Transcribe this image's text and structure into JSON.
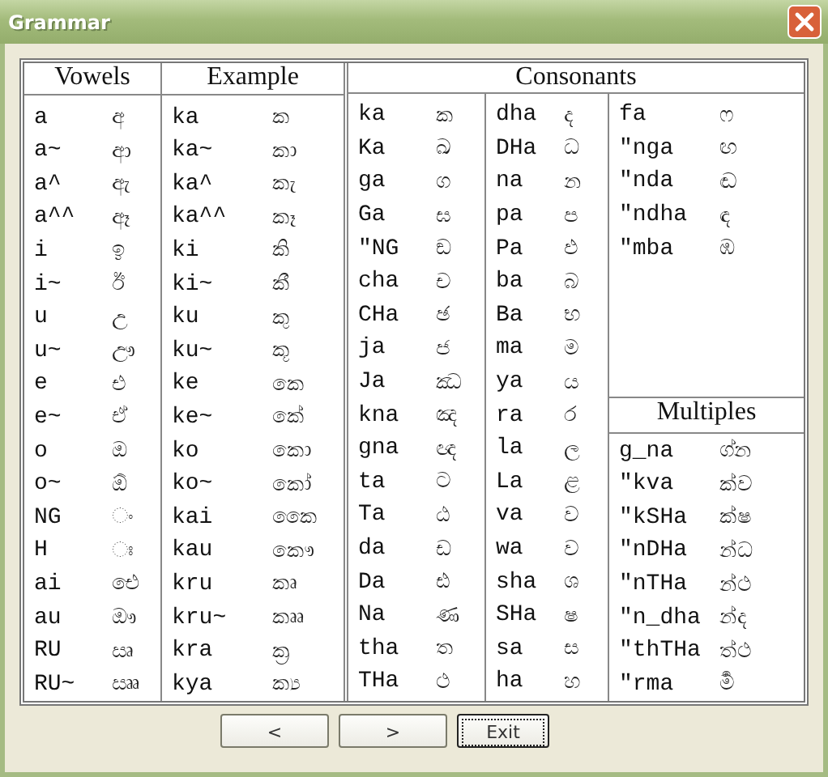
{
  "window": {
    "title": "Grammar"
  },
  "vowels": {
    "header": "Vowels",
    "rows": [
      {
        "code": "a",
        "glyph": "අ"
      },
      {
        "code": "a~",
        "glyph": "ආ"
      },
      {
        "code": "a^",
        "glyph": "ඇ"
      },
      {
        "code": "a^^",
        "glyph": "ඈ"
      },
      {
        "code": "i",
        "glyph": "ඉ"
      },
      {
        "code": "i~",
        "glyph": "ඊ"
      },
      {
        "code": "u",
        "glyph": "උ"
      },
      {
        "code": "u~",
        "glyph": "ඌ"
      },
      {
        "code": "e",
        "glyph": "එ"
      },
      {
        "code": "e~",
        "glyph": "ඒ"
      },
      {
        "code": "o",
        "glyph": "ඔ"
      },
      {
        "code": "o~",
        "glyph": "ඕ"
      },
      {
        "code": "NG",
        "glyph": "ං"
      },
      {
        "code": "H",
        "glyph": "ඃ"
      },
      {
        "code": "ai",
        "glyph": "ඓ"
      },
      {
        "code": "au",
        "glyph": "ඖ"
      },
      {
        "code": "RU",
        "glyph": "ඍ"
      },
      {
        "code": "RU~",
        "glyph": "ඎ"
      }
    ]
  },
  "example": {
    "header": "Example",
    "rows": [
      {
        "code": "ka",
        "glyph": "ක"
      },
      {
        "code": "ka~",
        "glyph": "කා"
      },
      {
        "code": "ka^",
        "glyph": "කැ"
      },
      {
        "code": "ka^^",
        "glyph": "කෑ"
      },
      {
        "code": "ki",
        "glyph": "කි"
      },
      {
        "code": "ki~",
        "glyph": "කී"
      },
      {
        "code": "ku",
        "glyph": "කු"
      },
      {
        "code": "ku~",
        "glyph": "කූ"
      },
      {
        "code": "ke",
        "glyph": "කෙ"
      },
      {
        "code": "ke~",
        "glyph": "කේ"
      },
      {
        "code": "ko",
        "glyph": "කො"
      },
      {
        "code": "ko~",
        "glyph": "කෝ"
      },
      {
        "code": "kai",
        "glyph": "කෛ"
      },
      {
        "code": "kau",
        "glyph": "කෞ"
      },
      {
        "code": "kru",
        "glyph": "කෘ"
      },
      {
        "code": "kru~",
        "glyph": "කෲ"
      },
      {
        "code": "kra",
        "glyph": "ක්‍ර"
      },
      {
        "code": "kya",
        "glyph": "ක්‍ය"
      }
    ]
  },
  "consonants": {
    "header": "Consonants",
    "columns": [
      [
        {
          "code": "ka",
          "glyph": "ක"
        },
        {
          "code": "Ka",
          "glyph": "ඛ"
        },
        {
          "code": "ga",
          "glyph": "ග"
        },
        {
          "code": "Ga",
          "glyph": "ඝ"
        },
        {
          "code": "\"NG",
          "glyph": "ඞ"
        },
        {
          "code": "cha",
          "glyph": "ච"
        },
        {
          "code": "CHa",
          "glyph": "ඡ"
        },
        {
          "code": "ja",
          "glyph": "ජ"
        },
        {
          "code": "Ja",
          "glyph": "ඣ"
        },
        {
          "code": "kna",
          "glyph": "ඤ"
        },
        {
          "code": "gna",
          "glyph": "ඥ"
        },
        {
          "code": "ta",
          "glyph": "ට"
        },
        {
          "code": "Ta",
          "glyph": "ඨ"
        },
        {
          "code": "da",
          "glyph": "ඩ"
        },
        {
          "code": "Da",
          "glyph": "ඪ"
        },
        {
          "code": "Na",
          "glyph": "ණ"
        },
        {
          "code": "tha",
          "glyph": "ත"
        },
        {
          "code": "THa",
          "glyph": "ථ"
        }
      ],
      [
        {
          "code": "dha",
          "glyph": "ද"
        },
        {
          "code": "DHa",
          "glyph": "ධ"
        },
        {
          "code": "na",
          "glyph": "න"
        },
        {
          "code": "pa",
          "glyph": "ප"
        },
        {
          "code": "Pa",
          "glyph": "ඵ"
        },
        {
          "code": "ba",
          "glyph": "බ"
        },
        {
          "code": "Ba",
          "glyph": "භ"
        },
        {
          "code": "ma",
          "glyph": "ම"
        },
        {
          "code": "ya",
          "glyph": "ය"
        },
        {
          "code": "ra",
          "glyph": "ර"
        },
        {
          "code": "la",
          "glyph": "ල"
        },
        {
          "code": "La",
          "glyph": "ළ"
        },
        {
          "code": "va",
          "glyph": "ව"
        },
        {
          "code": "wa",
          "glyph": "ව"
        },
        {
          "code": "sha",
          "glyph": "ශ"
        },
        {
          "code": "SHa",
          "glyph": "ෂ"
        },
        {
          "code": "sa",
          "glyph": "ස"
        },
        {
          "code": "ha",
          "glyph": "හ"
        }
      ],
      [
        {
          "code": "fa",
          "glyph": "ෆ"
        },
        {
          "code": "\"nga",
          "glyph": "ඟ"
        },
        {
          "code": "\"nda",
          "glyph": "ඬ"
        },
        {
          "code": "\"ndha",
          "glyph": "ඳ"
        },
        {
          "code": "\"mba",
          "glyph": "ඹ"
        }
      ]
    ]
  },
  "multiples": {
    "header": "Multiples",
    "rows": [
      {
        "code": "g_na",
        "glyph": "ග්න"
      },
      {
        "code": "\"kva",
        "glyph": "ක්ව"
      },
      {
        "code": "\"kSHa",
        "glyph": "ක්ෂ"
      },
      {
        "code": "\"nDHa",
        "glyph": "න්ධ"
      },
      {
        "code": "\"nTHa",
        "glyph": "න්ථ"
      },
      {
        "code": "\"n_dha",
        "glyph": "න්ද"
      },
      {
        "code": "\"thTHa",
        "glyph": "ත්ථ"
      },
      {
        "code": "\"rma",
        "glyph": "ර්‍ම"
      }
    ]
  },
  "buttons": [
    {
      "label": "<",
      "focused": false
    },
    {
      "label": ">",
      "focused": false
    },
    {
      "label": "Exit",
      "focused": true
    }
  ]
}
